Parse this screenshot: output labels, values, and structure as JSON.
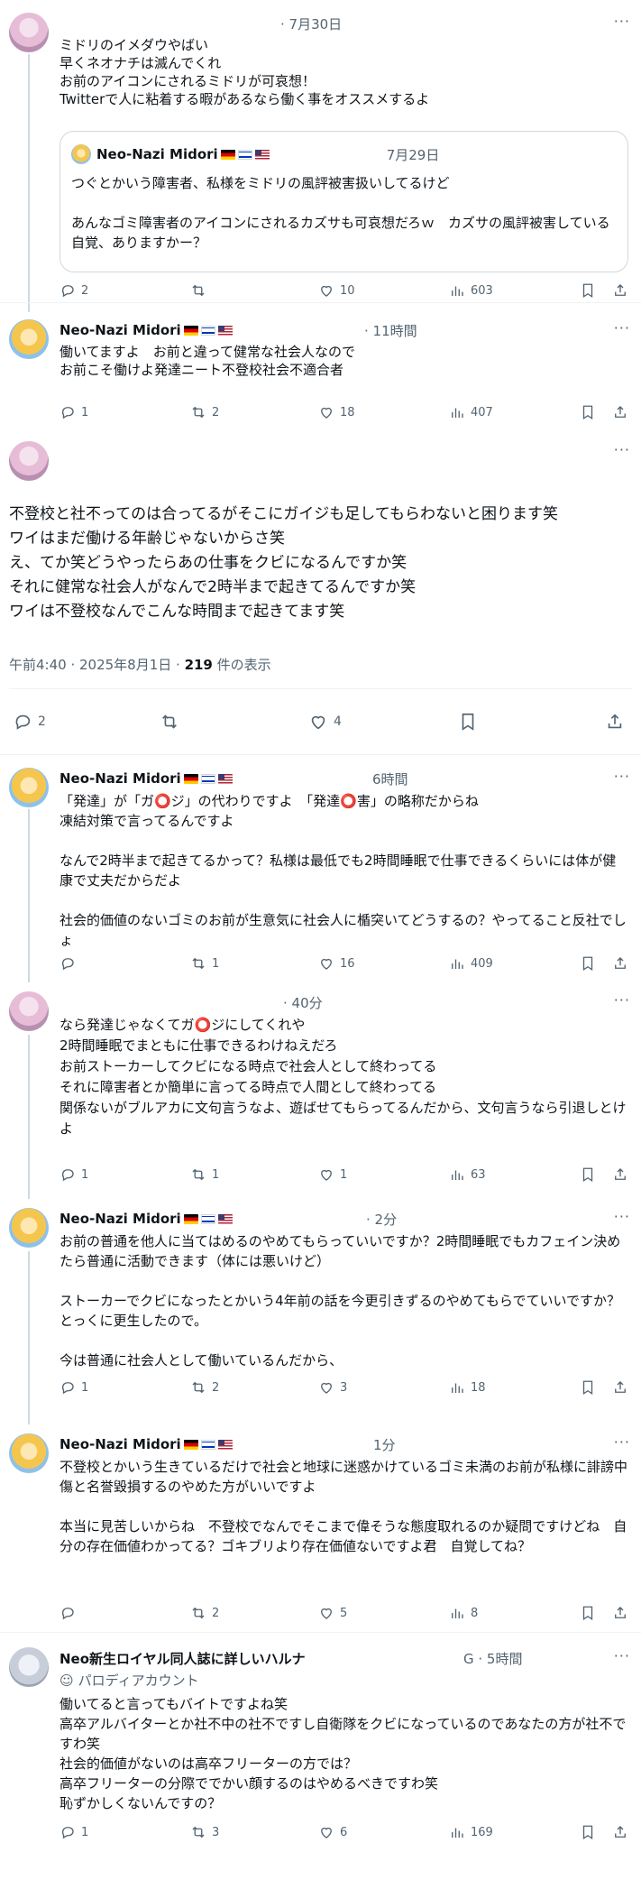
{
  "tweet1": {
    "time": "· 7月30日",
    "text": "ミドリのイメダウやばい\n早くネオナチは滅んでくれ\nお前のアイコンにされるミドリが可哀想！\nTwitterで人に粘着する暇があるなら働く事をオススメするよ",
    "quote": {
      "name": "Neo-Nazi Midori",
      "time": "7月29日",
      "text": "つぐとかいう障害者、私様をミドリの風評被害扱いしてるけど\n\nあんなゴミ障害者のアイコンにされるカズサも可哀想だろｗ　カズサの風評被害している自覚、ありますかー？"
    },
    "replies": "2",
    "retweets": "",
    "likes": "10",
    "views": "603"
  },
  "tweet2": {
    "name": "Neo-Nazi Midori",
    "time": "· 11時間",
    "text": "働いてますよ　お前と違って健常な社会人なので\nお前こそ働けよ発達ニート不登校社会不適合者",
    "replies": "1",
    "retweets": "2",
    "likes": "18",
    "views": "407"
  },
  "main": {
    "text": "不登校と社不ってのは合ってるがそこにガイジも足してもらわないと困ります笑\nワイはまだ働ける年齢じゃないからさ笑\nえ、てか笑どうやったらあの仕事をクビになるんですか笑\nそれに健常な社会人がなんで2時半まで起きてるんですか笑\nワイは不登校なんでこんな時間まで起きてます笑",
    "timestamp": "午前4:40 · 2025年8月1日 · ",
    "views_count": "219",
    "views_label": " 件の表示",
    "replies": "2",
    "retweets": "",
    "likes": "4"
  },
  "tweet3": {
    "name": "Neo-Nazi Midori",
    "time": "6時間",
    "text": "「発達」が「ガ⭕ジ」の代わりですよ　「発達⭕害」の略称だからね\n凍結対策で言ってるんですよ\n\nなんで2時半まで起きてるかって？私様は最低でも2時間睡眠で仕事できるくらいには体が健康で丈夫だからだよ\n\n社会的価値のないゴミのお前が生意気に社会人に楯突いてどうするの？やってること反社でしょ",
    "replies": "",
    "retweets": "1",
    "likes": "16",
    "views": "409"
  },
  "tweet4": {
    "time": "· 40分",
    "text": "なら発達じゃなくてガ⭕ジにしてくれや\n2時間睡眠でまともに仕事できるわけねえだろ\nお前ストーカーしてクビになる時点で社会人として終わってる\nそれに障害者とか簡単に言ってる時点で人間として終わってる\n関係ないがブルアカに文句言うなよ、遊ばせてもらってるんだから、文句言うなら引退しとけよ",
    "replies": "1",
    "retweets": "1",
    "likes": "1",
    "views": "63"
  },
  "tweet5": {
    "name": "Neo-Nazi Midori",
    "time": "· 2分",
    "text": "お前の普通を他人に当てはめるのやめてもらっていいですか？2時間睡眠でもカフェイン決めたら普通に活動できます（体には悪いけど）\n\nストーカーでクビになったとかいう4年前の話を今更引きずるのやめてもらでていいですか？とっくに更生したので。\n\n今は普通に社会人として働いているんだから、",
    "replies": "1",
    "retweets": "2",
    "likes": "3",
    "views": "18"
  },
  "tweet6": {
    "name": "Neo-Nazi Midori",
    "time": "1分",
    "text": "不登校とかいう生きているだけで社会と地球に迷惑かけているゴミ未満のお前が私様に誹謗中傷と名誉毀損するのやめた方がいいですよ\n\n本当に見苦しいからね　不登校でなんでそこまで偉そうな態度取れるのか疑問ですけどね　自分の存在価値わかってる？ゴキブリより存在価値ないですよ君　自覚してね？",
    "replies": "",
    "retweets": "2",
    "likes": "5",
    "views": "8"
  },
  "tweet7": {
    "name": "Neo新生ロイヤル同人誌に詳しいハルナ",
    "time": "G · 5時間",
    "parody": "パロディアカウント",
    "text": "働いてると言ってもバイトですよね笑\n高卒アルバイターとか社不中の社不ですし自衛隊をクビになっているのであなたの方が社不ですわ笑\n社会的価値がないのは高卒フリーターの方では？\n高卒フリーターの分際ででかい顔するのはやめるべきですわ笑\n恥ずかしくないんですの？",
    "replies": "1",
    "retweets": "3",
    "likes": "6",
    "views": "169"
  },
  "more_icon": "···"
}
